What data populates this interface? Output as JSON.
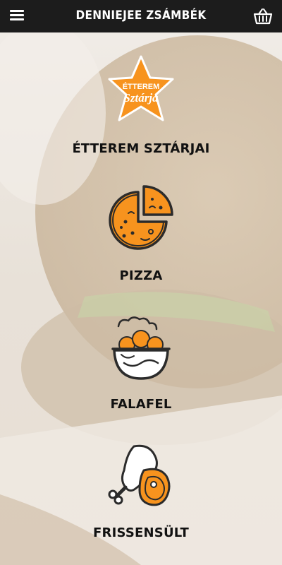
{
  "app": {
    "title": "DENNIEJEE ZSÁMBÉK"
  },
  "icons": {
    "menu": "hamburger-menu-icon",
    "basket": "shopping-basket-icon"
  },
  "colors": {
    "accent": "#f7931e",
    "topbar": "#1c1c1c",
    "icon_stroke": "#2b2b2b"
  },
  "badge": {
    "line1": "ÉTTEREM",
    "line2": "Sztárja"
  },
  "categories": [
    {
      "label": "ÉTTEREM SZTÁRJAI",
      "icon": "star-badge-icon"
    },
    {
      "label": "PIZZA",
      "icon": "pizza-icon"
    },
    {
      "label": "FALAFEL",
      "icon": "falafel-bowl-icon"
    },
    {
      "label": "FRISSENSÜLT",
      "icon": "chicken-leg-steak-icon"
    }
  ]
}
